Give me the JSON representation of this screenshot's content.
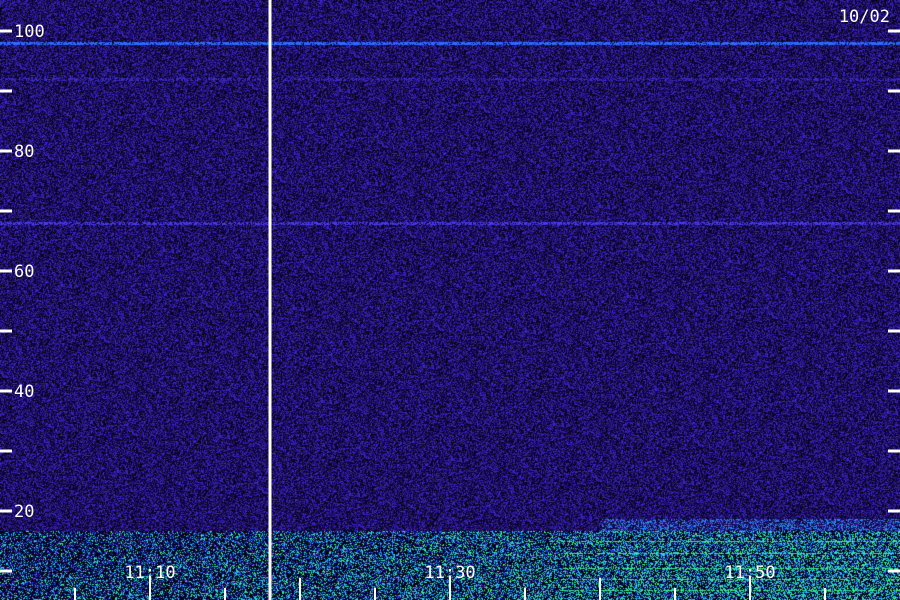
{
  "date_label": "10/02",
  "chart_data": {
    "type": "heatmap",
    "title": "",
    "xlabel": "",
    "ylabel": "",
    "y_ticks": [
      20,
      40,
      60,
      80,
      100
    ],
    "y_minor_ticks": [
      10,
      30,
      50,
      70,
      90
    ],
    "ylim": [
      5,
      105
    ],
    "x_tick_labels": [
      "11:10",
      "11:30",
      "11:50"
    ],
    "x_range_minutes": [
      "11:00",
      "12:00"
    ],
    "marker_time": "11:18",
    "colors": {
      "background": "#1c0c52",
      "noise_low": "#2a1a8a",
      "noise_high": "#3a2ad0",
      "hot_band": "#30e0ff",
      "hot_peak": "#40ff80",
      "tick": "#ffffff"
    },
    "bands": [
      {
        "y": 98,
        "strength": "strong"
      },
      {
        "y": 68,
        "strength": "medium"
      },
      {
        "y": 92,
        "strength": "weak"
      }
    ]
  }
}
